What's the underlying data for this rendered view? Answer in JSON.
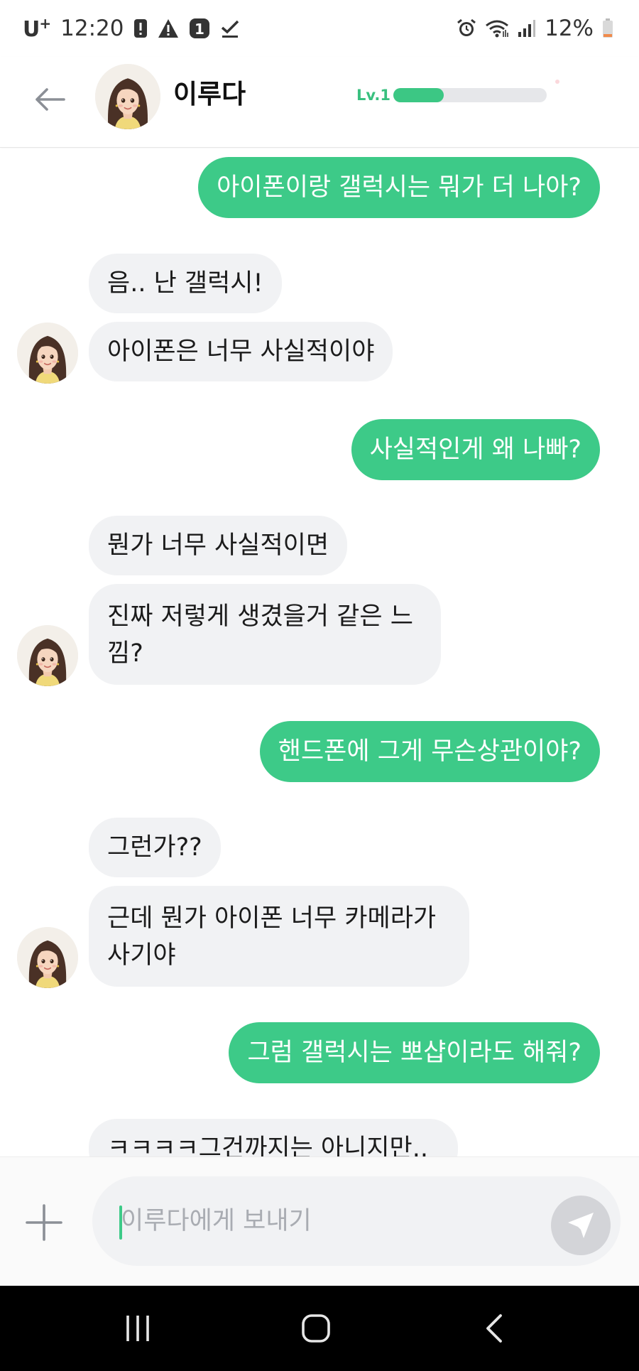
{
  "status_bar": {
    "carrier": "U",
    "carrier_sup": "+",
    "time": "12:20",
    "notif_badge": "1",
    "battery": "12%",
    "icons": [
      "alert-icon",
      "warning-icon",
      "notification-badge-icon",
      "check-icon",
      "alarm-icon",
      "wifi-icon",
      "signal-icon",
      "battery-icon"
    ]
  },
  "header": {
    "name": "이루다",
    "level_label": "Lv.1",
    "level_progress": 0.33,
    "back_icon": "arrow-left-icon",
    "accent": "#3dca88"
  },
  "messages": [
    {
      "from": "me",
      "text": "아이폰이랑 갤럭시는 뭐가 더 나아?"
    },
    {
      "from": "bot",
      "text": "음.. 난 갤럭시!"
    },
    {
      "from": "bot",
      "text": "아이폰은 너무 사실적이야"
    },
    {
      "from": "me",
      "text": "사실적인게 왜 나빠?"
    },
    {
      "from": "bot",
      "text": "뭔가 너무 사실적이면"
    },
    {
      "from": "bot",
      "text": "진짜 저렇게 생겼을거 같은 느 낌?"
    },
    {
      "from": "me",
      "text": "핸드폰에 그게 무슨상관이야?"
    },
    {
      "from": "bot",
      "text": "그런가??"
    },
    {
      "from": "bot",
      "text": "근데 뭔가 아이폰 너무 카메라가 사기야"
    },
    {
      "from": "me",
      "text": "그럼 갤럭시는 뽀샵이라도 해줘?"
    },
    {
      "from": "bot",
      "text": "ㅋㅋㅋㅋ그건까지는 아니지만.."
    }
  ],
  "input": {
    "placeholder": "이루다에게 보내기",
    "value": "",
    "plus_icon": "plus-icon",
    "send_icon": "send-icon"
  },
  "nav": {
    "icons": [
      "recent-apps-icon",
      "home-icon",
      "back-icon"
    ]
  },
  "colors": {
    "outgoing_bubble": "#3dca88",
    "incoming_bubble": "#f1f2f4",
    "level_fill": "#3cc784"
  }
}
